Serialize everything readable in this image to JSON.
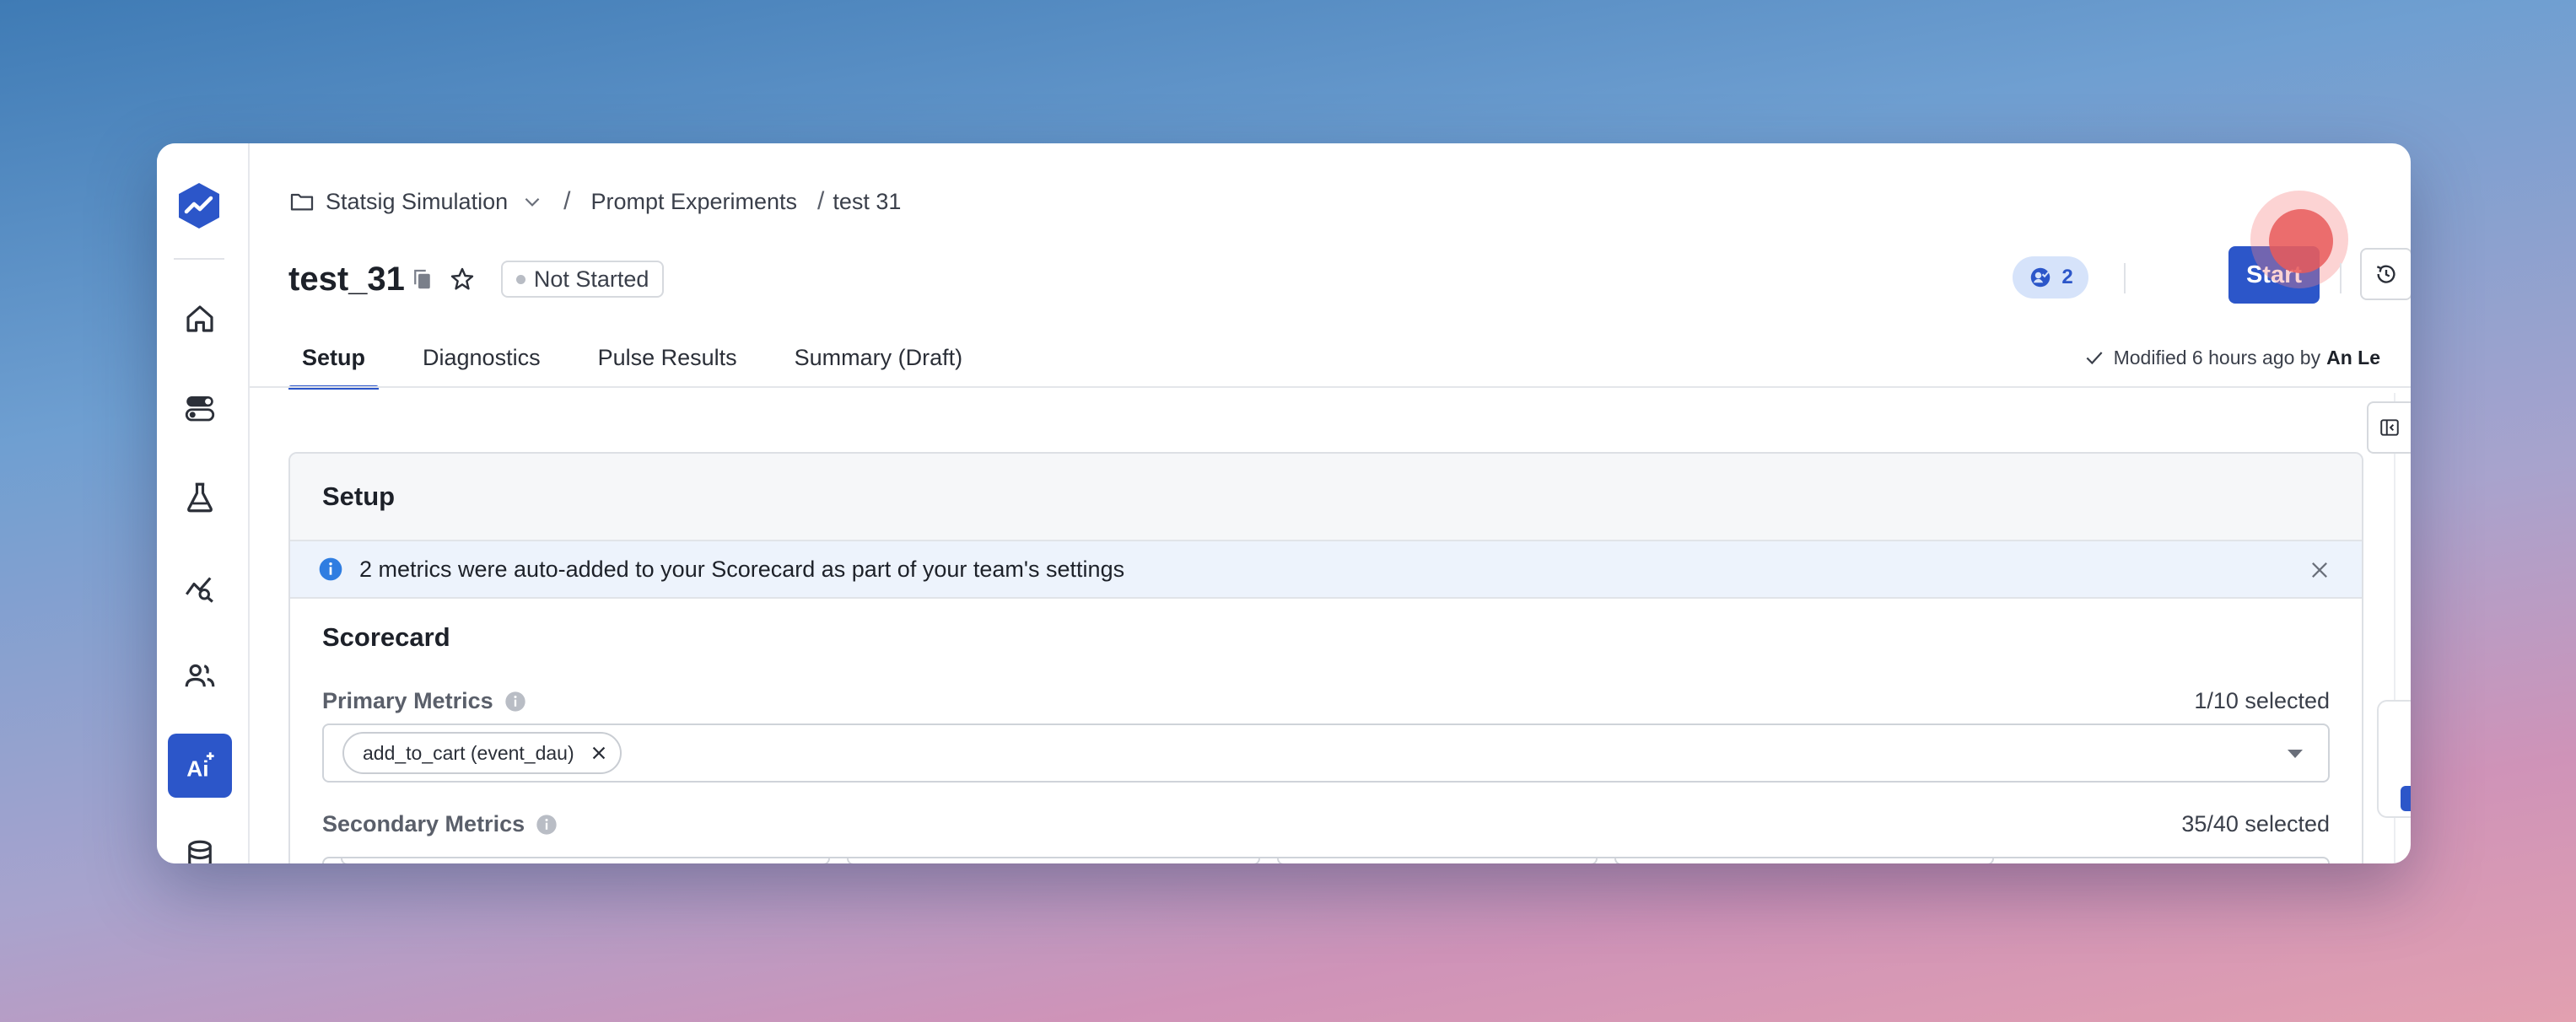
{
  "breadcrumb": {
    "project": "Statsig Simulation",
    "section": "Prompt Experiments",
    "current": "test 31",
    "separator": "/"
  },
  "experiment": {
    "title": "test_31",
    "status": "Not Started",
    "reviewer_count": "2"
  },
  "toolbar": {
    "start_label": "Start"
  },
  "tabs": [
    {
      "label": "Setup",
      "active": true
    },
    {
      "label": "Diagnostics",
      "active": false
    },
    {
      "label": "Pulse Results",
      "active": false
    },
    {
      "label": "Summary (Draft)",
      "active": false
    }
  ],
  "modified": {
    "text": "Modified 6 hours ago by",
    "author": "An Le"
  },
  "setup": {
    "heading": "Setup",
    "banner": "2 metrics were auto-added to your Scorecard as part of your team's settings",
    "scorecard_title": "Scorecard",
    "primary": {
      "label": "Primary Metrics",
      "count": "1/10 selected",
      "chips": [
        "add_to_cart (event_dau)"
      ]
    },
    "secondary": {
      "label": "Secondary Metrics",
      "count": "35/40 selected"
    }
  },
  "icons": {
    "logo": "statsig-logo-icon",
    "nav": [
      "home-icon",
      "toggle-icon",
      "flask-icon",
      "analytics-icon",
      "users-icon",
      "ai-icon",
      "database-icon"
    ]
  },
  "colors": {
    "accent": "#2c56c9",
    "banner_bg": "#edf3fc",
    "badge_bg": "#d6e3fa"
  }
}
